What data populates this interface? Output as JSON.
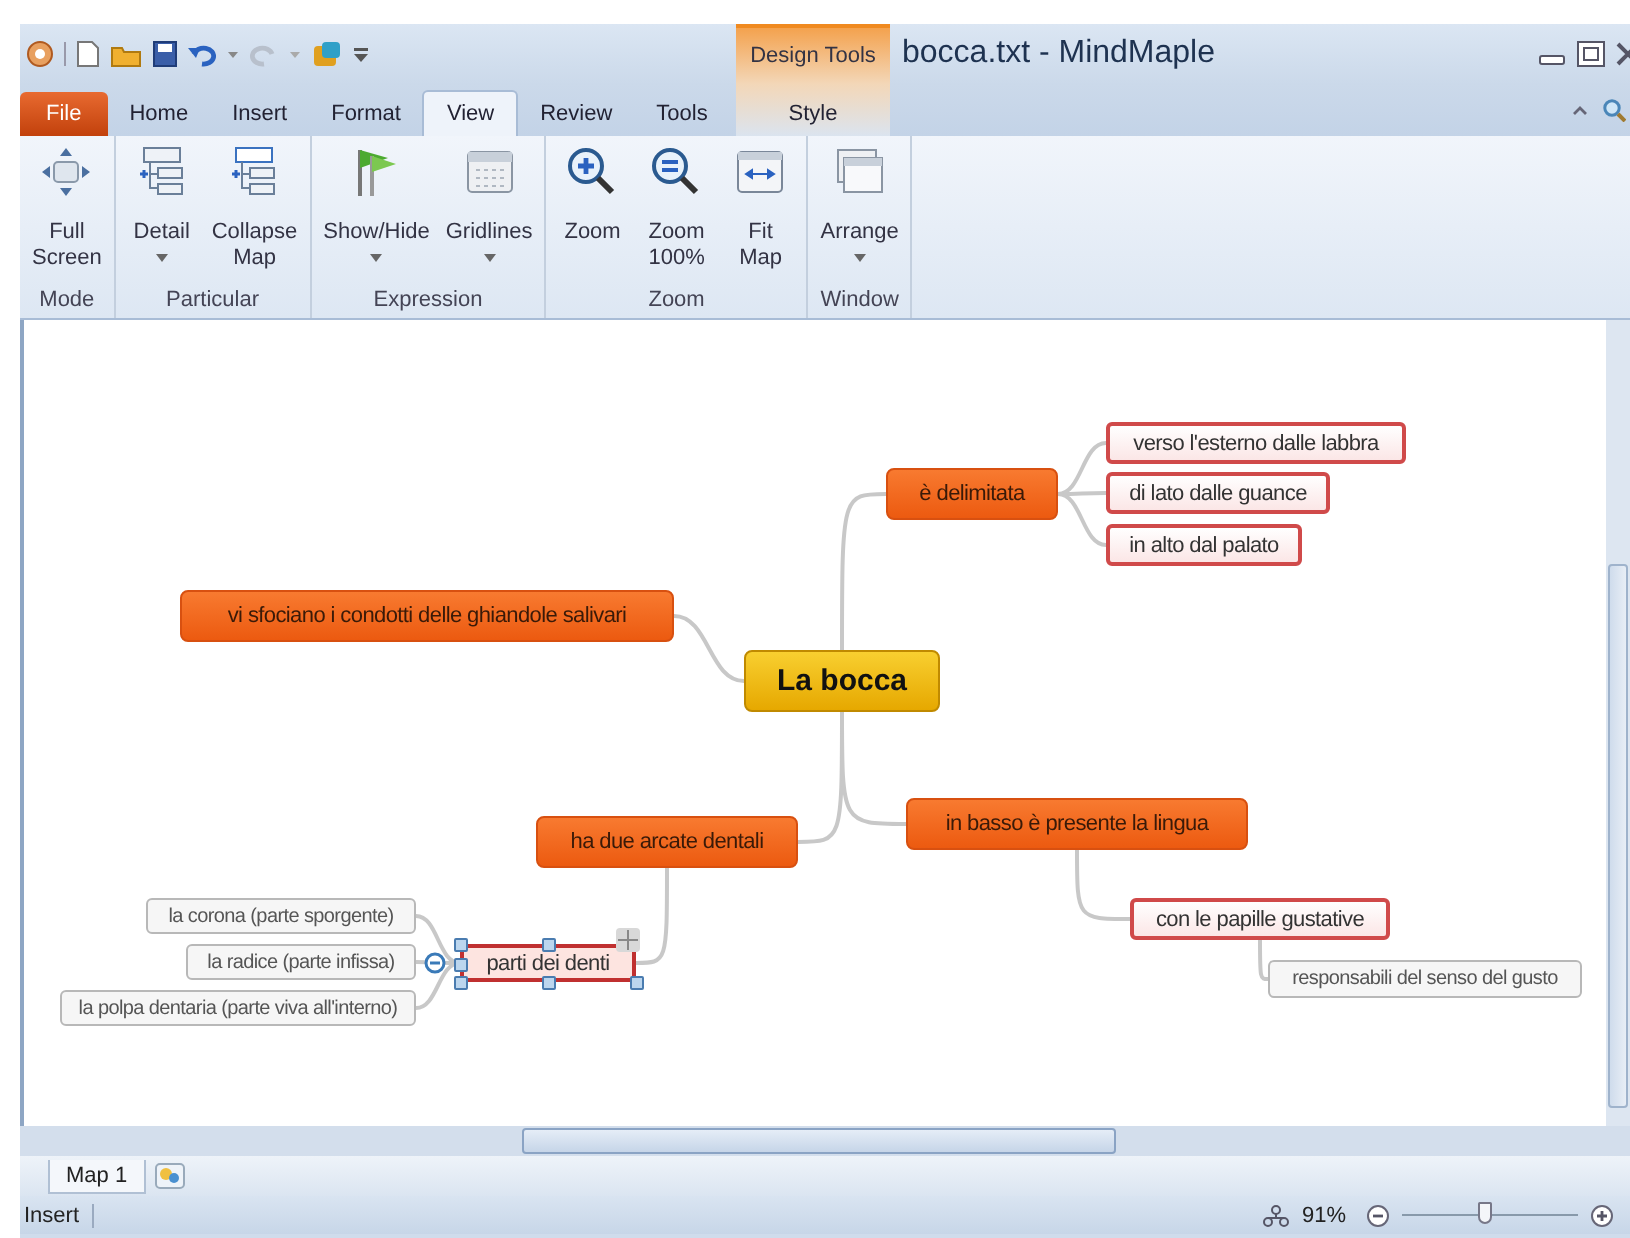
{
  "window": {
    "title": "bocca.txt - MindMaple"
  },
  "contextual_tabs": {
    "title": "Design Tools",
    "tabs": [
      {
        "label": "Style",
        "selected": false
      }
    ]
  },
  "tabs": [
    {
      "label": "File",
      "kind": "file",
      "selected": false
    },
    {
      "label": "Home",
      "kind": "tab",
      "selected": false
    },
    {
      "label": "Insert",
      "kind": "tab",
      "selected": false
    },
    {
      "label": "Format",
      "kind": "tab",
      "selected": false
    },
    {
      "label": "View",
      "kind": "tab",
      "selected": true
    },
    {
      "label": "Review",
      "kind": "tab",
      "selected": false
    },
    {
      "label": "Tools",
      "kind": "tab",
      "selected": false
    }
  ],
  "ribbon": {
    "groups": [
      {
        "label": "Mode",
        "buttons": [
          {
            "label": "Full Screen",
            "dropdown": false
          }
        ]
      },
      {
        "label": "Particular",
        "buttons": [
          {
            "label": "Detail",
            "dropdown": true
          },
          {
            "label": "Collapse Map",
            "dropdown": false
          }
        ]
      },
      {
        "label": "Expression",
        "buttons": [
          {
            "label": "Show/Hide",
            "dropdown": true
          },
          {
            "label": "Gridlines",
            "dropdown": true
          }
        ]
      },
      {
        "label": "Zoom",
        "buttons": [
          {
            "label": "Zoom",
            "dropdown": false
          },
          {
            "label": "Zoom 100%",
            "dropdown": false
          },
          {
            "label": "Fit Map",
            "dropdown": false
          }
        ]
      },
      {
        "label": "Window",
        "buttons": [
          {
            "label": "Arrange",
            "dropdown": true
          }
        ]
      }
    ]
  },
  "map": {
    "root": {
      "text": "La bocca",
      "kind": "central",
      "selected": false,
      "children": [
        {
          "text": "è delimitata",
          "kind": "topic",
          "selected": false,
          "children": [
            {
              "text": "verso l'esterno dalle labbra",
              "kind": "subtopic",
              "selected": false
            },
            {
              "text": "di lato dalle guance",
              "kind": "subtopic",
              "selected": false
            },
            {
              "text": "in alto dal palato",
              "kind": "subtopic",
              "selected": false
            }
          ]
        },
        {
          "text": "vi sfociano i condotti delle ghiandole salivari",
          "kind": "topic",
          "selected": false
        },
        {
          "text": "ha due arcate dentali",
          "kind": "topic",
          "selected": false,
          "children": [
            {
              "text": "parti dei denti",
              "kind": "subtopic",
              "selected": true,
              "children": [
                {
                  "text": "la corona (parte sporgente)",
                  "kind": "detail",
                  "selected": false
                },
                {
                  "text": "la radice (parte infissa)",
                  "kind": "detail",
                  "selected": false
                },
                {
                  "text": "la polpa dentaria (parte viva all'interno)",
                  "kind": "detail",
                  "selected": false
                }
              ]
            }
          ]
        },
        {
          "text": "in basso è presente la lingua",
          "kind": "topic",
          "selected": false,
          "children": [
            {
              "text": "con le papille gustative",
              "kind": "subtopic",
              "selected": false,
              "children": [
                {
                  "text": "responsabili del senso del gusto",
                  "kind": "detail",
                  "selected": false
                }
              ]
            }
          ]
        }
      ]
    }
  },
  "map_tabs": [
    {
      "label": "Map 1",
      "selected": true
    }
  ],
  "status_bar": {
    "mode": "Insert",
    "zoom": "91%",
    "zoom_slider": {
      "level": 0.47
    }
  }
}
